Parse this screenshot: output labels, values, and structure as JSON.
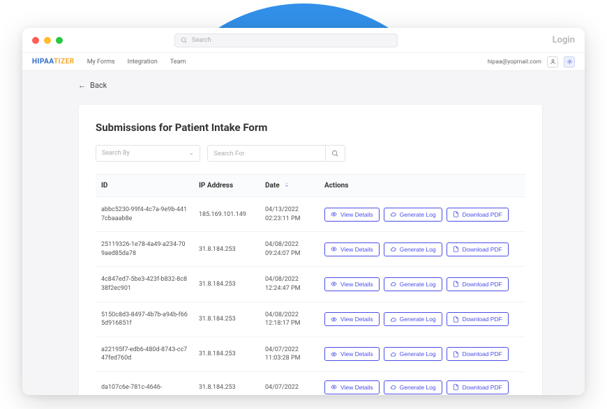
{
  "header": {
    "search_placeholder": "Search",
    "login_label": "Login"
  },
  "nav": {
    "logo_a": "HIPAA",
    "logo_b": "TIZER",
    "items": [
      "My Forms",
      "Integration",
      "Team"
    ],
    "user_email": "hipaa@yopmail.com"
  },
  "page": {
    "back_label": "Back",
    "title": "Submissions for Patient Intake Form",
    "search_by_placeholder": "Search By",
    "search_for_placeholder": "Search For"
  },
  "table": {
    "headers": {
      "id": "ID",
      "ip": "IP Address",
      "date": "Date",
      "actions": "Actions"
    },
    "action_labels": {
      "view": "View Details",
      "log": "Generate Log",
      "pdf": "Download PDF"
    },
    "rows": [
      {
        "id": "abbc5230-99f4-4c7a-9e9b-4417cbaaab8e",
        "ip": "185.169.101.149",
        "date": "04/13/2022 02:23:11 PM"
      },
      {
        "id": "25119326-1e78-4a49-a234-709aed85da78",
        "ip": "31.8.184.253",
        "date": "04/08/2022 09:24:07 PM"
      },
      {
        "id": "4c847ed7-5be3-423f-b832-8c838f2ec901",
        "ip": "31.8.184.253",
        "date": "04/08/2022 12:24:47 PM"
      },
      {
        "id": "5150c8d3-8497-4b7b-a94b-f665d916851f",
        "ip": "31.8.184.253",
        "date": "04/08/2022 12:18:17 PM"
      },
      {
        "id": "a22195f7-edb6-480d-8743-cc747fed760d",
        "ip": "31.8.184.253",
        "date": "04/07/2022 11:03:28 PM"
      },
      {
        "id": "da107c6e-781c-4646-",
        "ip": "31.8.184.253",
        "date": "04/07/2022"
      }
    ]
  }
}
